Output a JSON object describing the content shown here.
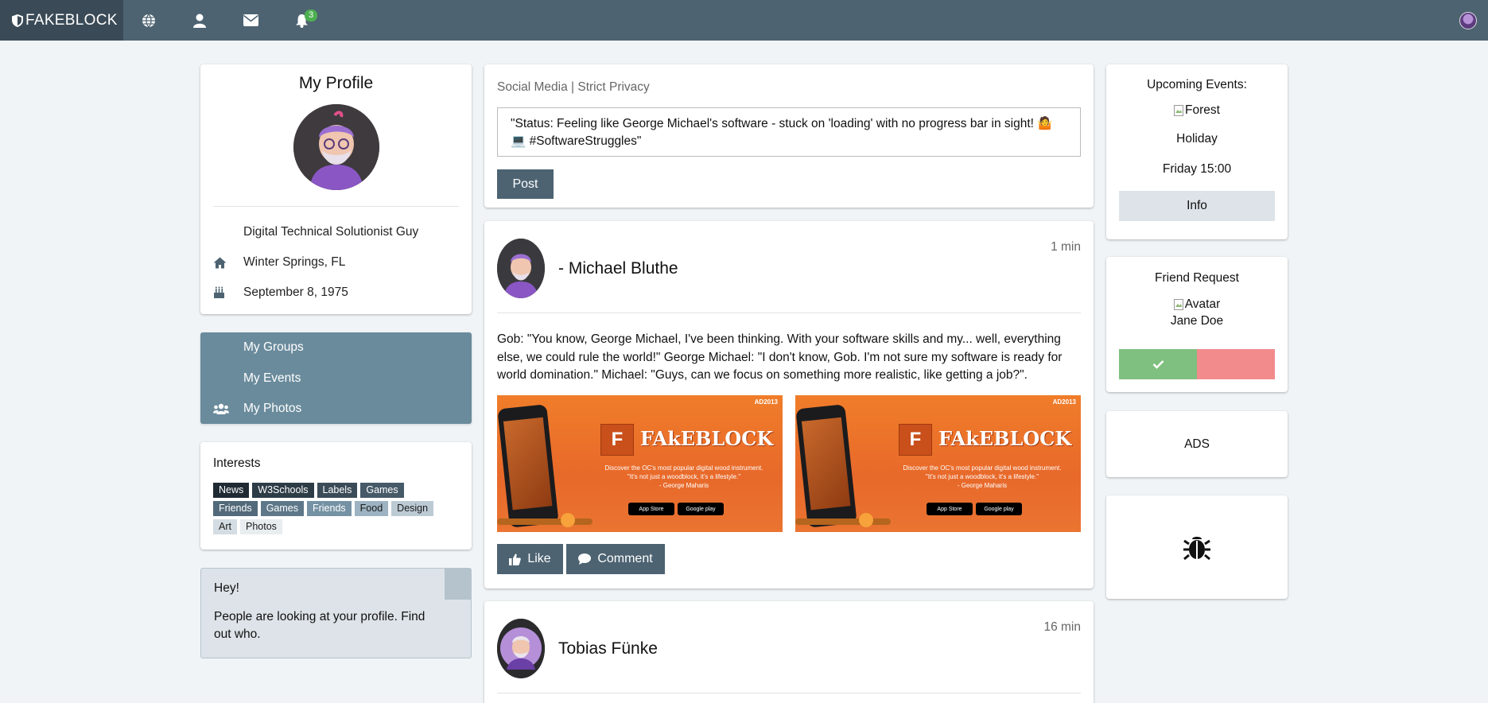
{
  "topbar": {
    "brand": "FAKEBLOCK",
    "notifications_count": "3",
    "icons": [
      "globe-icon",
      "user-icon",
      "envelope-icon",
      "bell-icon"
    ]
  },
  "profile": {
    "title": "My Profile",
    "job": "Digital Technical Solutionist Guy",
    "location": "Winter Springs, FL",
    "birthday": "September 8, 1975"
  },
  "menu": {
    "items": [
      {
        "label": "My Groups"
      },
      {
        "label": "My Events"
      },
      {
        "label": "My Photos"
      }
    ]
  },
  "interests": {
    "title": "Interests",
    "tags": [
      {
        "label": "News",
        "bg": "#1f2a33",
        "fg": "#ffffff"
      },
      {
        "label": "W3Schools",
        "bg": "#2e3c46",
        "fg": "#ffffff"
      },
      {
        "label": "Labels",
        "bg": "#3b4b57",
        "fg": "#ffffff"
      },
      {
        "label": "Games",
        "bg": "#465a68",
        "fg": "#ffffff"
      },
      {
        "label": "Friends",
        "bg": "#526a7a",
        "fg": "#ffffff"
      },
      {
        "label": "Games",
        "bg": "#5e7889",
        "fg": "#ffffff"
      },
      {
        "label": "Friends",
        "bg": "#7592a4",
        "fg": "#ffffff"
      },
      {
        "label": "Food",
        "bg": "#9db3c1",
        "fg": "#1a1a1a"
      },
      {
        "label": "Design",
        "bg": "#bccad4",
        "fg": "#1a1a1a"
      },
      {
        "label": "Art",
        "bg": "#d4dde3",
        "fg": "#1a1a1a"
      },
      {
        "label": "Photos",
        "bg": "#e8edf0",
        "fg": "#1a1a1a"
      }
    ]
  },
  "alert": {
    "title": "Hey!",
    "text": "People are looking at your profile. Find out who."
  },
  "composer": {
    "header": "Social Media | Strict Privacy",
    "status_text": "\"Status: Feeling like George Michael's software - stuck on 'loading' with no progress bar in sight! 🤷 💻 #SoftwareStruggles\"",
    "post_label": "Post"
  },
  "posts": [
    {
      "author": "- Michael Bluthe",
      "time": "1 min",
      "text": "Gob: \"You know, George Michael, I've been thinking. With your software skills and my... well, everything else, we could rule the world!\" George Michael: \"I don't know, Gob. I'm not sure my software is ready for world domination.\" Michael: \"Guys, can we focus on something more realistic, like getting a job?\".",
      "ad": {
        "badge": "AD2013",
        "brand_letter": "F",
        "brand_name": "FAkEBLOCK",
        "line1": "Discover the OC's most popular digital wood instrument.",
        "line2": "\"It's not just a woodblock, it's a lifestyle.\"",
        "line3": "- George Maharis",
        "store1": "App Store",
        "store2": "Google play"
      },
      "like_label": "Like",
      "comment_label": "Comment"
    },
    {
      "author": "Tobias Fünke",
      "time": "16 min"
    }
  ],
  "events": {
    "title": "Upcoming Events:",
    "image_alt": "Forest",
    "name": "Holiday",
    "when": "Friday 15:00",
    "info_label": "Info"
  },
  "friend_request": {
    "title": "Friend Request",
    "image_alt": "Avatar",
    "name": "Jane Doe",
    "accept_color": "#7fbf7f",
    "decline_color": "#f28b8b"
  },
  "ads": {
    "label": "ADS"
  },
  "colors": {
    "nav": "#4d6372",
    "brand_bg": "#3a4b57",
    "menu_bg": "#6a8b9c",
    "badge": "#4caf50"
  }
}
